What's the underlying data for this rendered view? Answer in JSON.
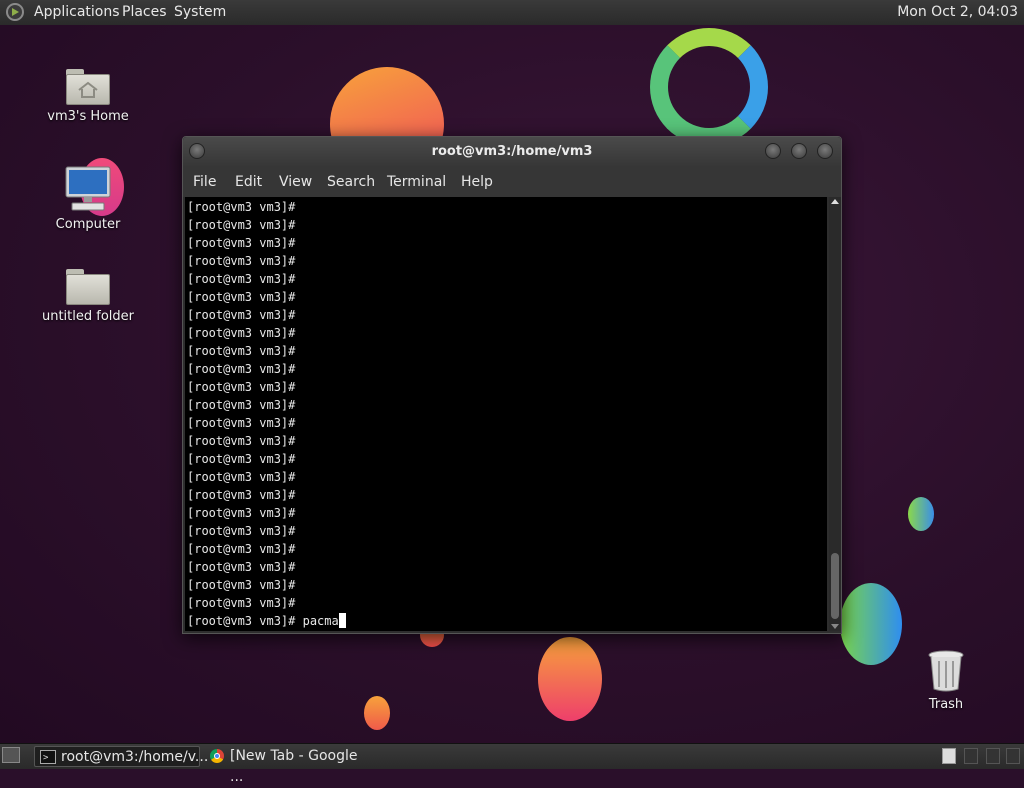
{
  "top_panel": {
    "menus": [
      "Applications",
      "Places",
      "System"
    ],
    "clock": "Mon Oct  2, 04:03"
  },
  "desktop_icons": {
    "home": "vm3's Home",
    "computer": "Computer",
    "folder": "untitled folder",
    "trash": "Trash"
  },
  "terminal": {
    "title": "root@vm3:/home/vm3",
    "menus": [
      "File",
      "Edit",
      "View",
      "Search",
      "Terminal",
      "Help"
    ],
    "prompt": "[root@vm3 vm3]#",
    "empty_prompt_lines": 23,
    "current_command": "pacma"
  },
  "taskbar": {
    "tasks": [
      "root@vm3:/home/v...",
      "[New Tab - Google ..."
    ]
  },
  "colors": {
    "panel": "#2f2f2f",
    "desktop_bg": "#2b0f2a",
    "terminal_bg": "#000000",
    "terminal_fg": "#e8e8e8"
  }
}
